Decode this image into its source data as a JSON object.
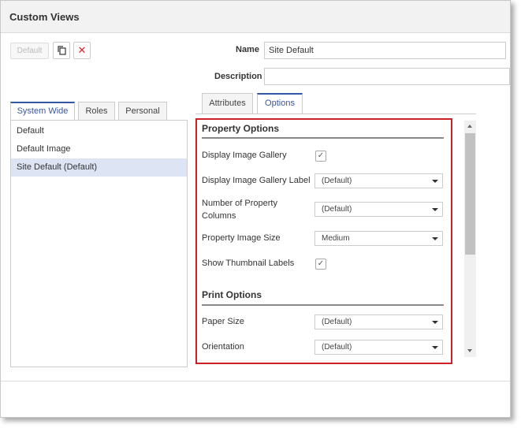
{
  "window": {
    "title": "Custom Views"
  },
  "toolbar": {
    "default_label": "Default",
    "copy_icon": "copy-icon",
    "delete_icon": "close-icon",
    "delete_glyph": "✕",
    "delete_color": "#d9262c"
  },
  "left_tabs": [
    {
      "label": "System Wide",
      "active": true
    },
    {
      "label": "Roles",
      "active": false
    },
    {
      "label": "Personal",
      "active": false
    }
  ],
  "views_list": [
    {
      "label": "Default",
      "selected": false
    },
    {
      "label": "Default Image",
      "selected": false
    },
    {
      "label": "Site Default (Default)",
      "selected": true
    }
  ],
  "form": {
    "name_label": "Name",
    "name_value": "Site Default",
    "description_label": "Description",
    "description_value": ""
  },
  "right_tabs": [
    {
      "label": "Attributes",
      "active": false
    },
    {
      "label": "Options",
      "active": true
    }
  ],
  "property_options": {
    "title": "Property Options",
    "rows": [
      {
        "label": "Display Image Gallery",
        "type": "checkbox",
        "checked": true
      },
      {
        "label": "Display Image Gallery Label",
        "type": "select",
        "value": "(Default)"
      },
      {
        "label": "Number of Property Columns",
        "type": "select",
        "value": "(Default)"
      },
      {
        "label": "Property Image Size",
        "type": "select",
        "value": "Medium"
      },
      {
        "label": "Show Thumbnail Labels",
        "type": "checkbox",
        "checked": true
      }
    ]
  },
  "print_options": {
    "title": "Print Options",
    "rows": [
      {
        "label": "Paper Size",
        "type": "select",
        "value": "(Default)"
      },
      {
        "label": "Orientation",
        "type": "select",
        "value": "(Default)"
      }
    ]
  },
  "colors": {
    "accent": "#3555a5",
    "highlight_border": "#cc2026",
    "selected_row": "#dde4f4"
  },
  "check_glyph": "✓"
}
